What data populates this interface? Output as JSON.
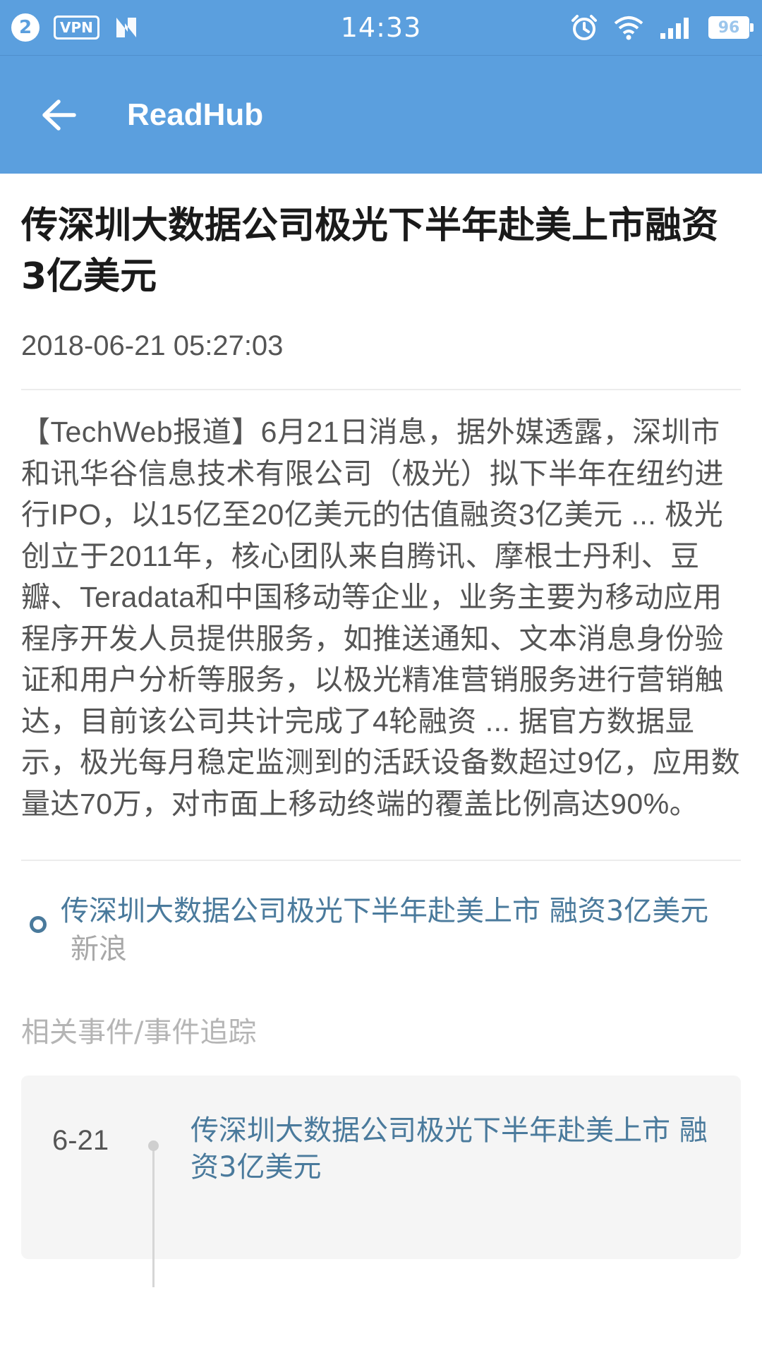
{
  "status_bar": {
    "notification_count": "2",
    "vpn_label": "VPN",
    "n_icon": "nfc-n-icon",
    "time": "14:33",
    "battery_level": "96",
    "icons": [
      "alarm-icon",
      "wifi-icon",
      "signal-icon",
      "battery-icon"
    ]
  },
  "app_bar": {
    "title": "ReadHub",
    "back_icon": "arrow-back-icon"
  },
  "article": {
    "title": "传深圳大数据公司极光下半年赴美上市融资3亿美元",
    "datetime": "2018-06-21  05:27:03",
    "body": "【TechWeb报道】6月21日消息，据外媒透露，深圳市和讯华谷信息技术有限公司（极光）拟下半年在纽约进行IPO，以15亿至20亿美元的估值融资3亿美元 ... 极光创立于2011年，核心团队来自腾讯、摩根士丹利、豆瓣、Teradata和中国移动等企业，业务主要为移动应用程序开发人员提供服务，如推送通知、文本消息身份验证和用户分析等服务，以极光精准营销服务进行营销触达，目前该公司共计完成了4轮融资 ... 据官方数据显示，极光每月稳定监测到的活跃设备数超过9亿，应用数量达70万，对市面上移动终端的覆盖比例高达90%。"
  },
  "source": {
    "title": "传深圳大数据公司极光下半年赴美上市 融资3亿美元",
    "name": "新浪"
  },
  "related": {
    "label": "相关事件/事件追踪",
    "items": [
      {
        "date": "6-21",
        "title": "传深圳大数据公司极光下半年赴美上市 融资3亿美元"
      }
    ]
  },
  "colors": {
    "primary": "#5b9fde",
    "link": "#4a7a9c"
  }
}
